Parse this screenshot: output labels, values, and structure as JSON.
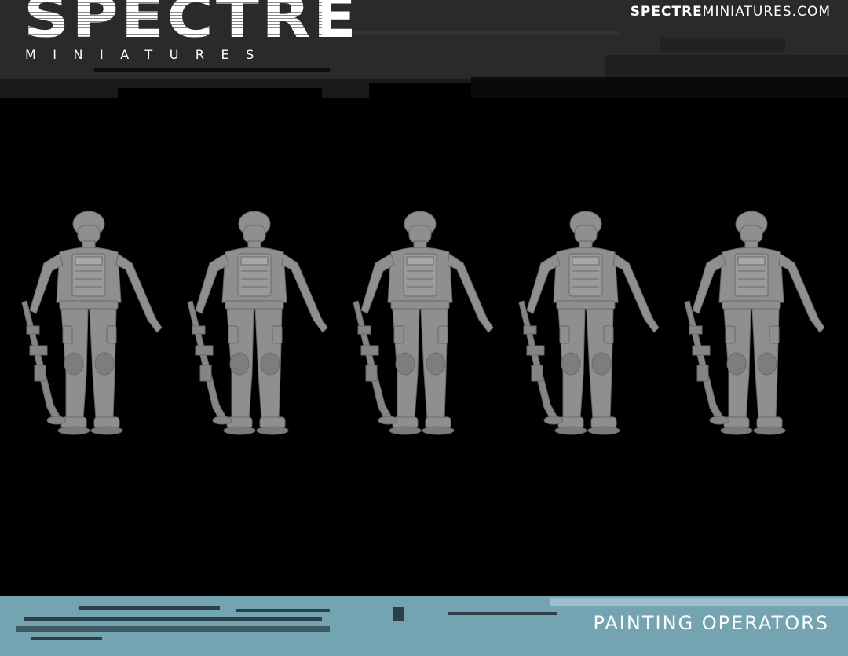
{
  "header": {
    "logo_word": "SPECTRE",
    "logo_subtitle": "MINIATURES",
    "site_url_bold": "SPECTRE",
    "site_url_rest": "MINIATURES.COM"
  },
  "stage": {
    "figure_count": 5,
    "figure_icon": "operator-miniature-icon",
    "figure_color": "#8f8f8f"
  },
  "footer": {
    "title": "PAINTING OPERATORS"
  },
  "colors": {
    "header_bg": "#2a2a2a",
    "stage_bg": "#000000",
    "footer_bg": "#74a4b2",
    "text": "#ffffff"
  }
}
